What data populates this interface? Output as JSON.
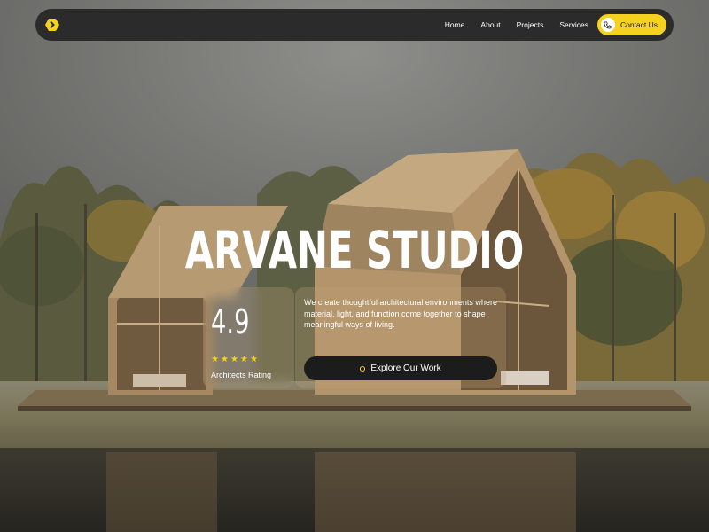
{
  "colors": {
    "accent": "#f5d21f",
    "navbar_bg": "#2b2b2b",
    "button_dark": "#1c1c1c",
    "text_light": "#ffffff"
  },
  "navbar": {
    "logo_icon": "hexagon-chevron-logo-icon",
    "links": [
      {
        "label": "Home"
      },
      {
        "label": "About"
      },
      {
        "label": "Projects"
      },
      {
        "label": "Services"
      }
    ],
    "contact": {
      "label": "Contact Us",
      "icon": "phone-icon"
    }
  },
  "hero": {
    "title": "ARVANE STUDIO",
    "rating": {
      "value": "4.9",
      "stars": 5,
      "label": "Architects Rating"
    },
    "description": "We create thoughtful architectural environments where material, light, and function come together to shape meaningful ways of living.",
    "cta": {
      "label": "Explore Our Work",
      "icon": "circle-dot-icon"
    }
  }
}
